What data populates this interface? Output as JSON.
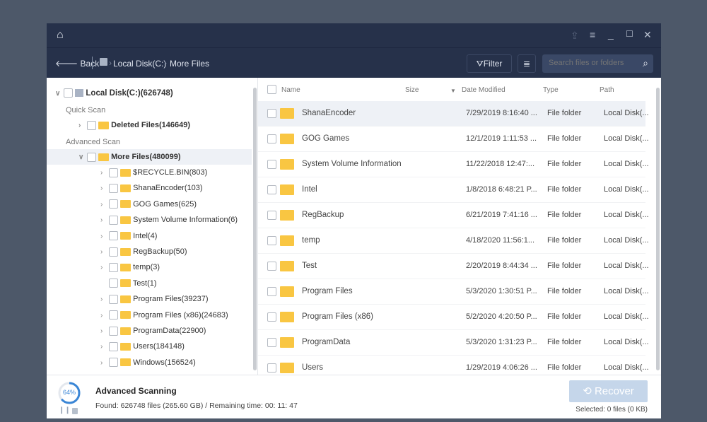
{
  "titlebar": {
    "icons": [
      "home-icon",
      "share-icon",
      "menu-icon",
      "minimize-icon",
      "maximize-icon",
      "close-icon"
    ]
  },
  "nav": {
    "back": "Back",
    "crumbs": [
      "Local Disk(C:)",
      "More Files"
    ],
    "filter": "Filter",
    "search_placeholder": "Search files or folders"
  },
  "tree": {
    "root": "Local Disk(C:)(626748)",
    "quick_scan": "Quick Scan",
    "deleted": "Deleted Files(146649)",
    "advanced_scan": "Advanced Scan",
    "more": "More Files(480099)",
    "children": [
      "$RECYCLE.BIN(803)",
      "ShanaEncoder(103)",
      "GOG Games(625)",
      "System Volume Information(6)",
      "Intel(4)",
      "RegBackup(50)",
      "temp(3)",
      "Test(1)",
      "Program Files(39237)",
      "Program Files (x86)(24683)",
      "ProgramData(22900)",
      "Users(184148)",
      "Windows(156524)"
    ]
  },
  "columns": {
    "name": "Name",
    "size": "Size",
    "date": "Date Modified",
    "type": "Type",
    "path": "Path"
  },
  "files": [
    {
      "name": "ShanaEncoder",
      "date": "7/29/2019 8:16:40 ...",
      "type": "File folder",
      "path": "Local Disk(..."
    },
    {
      "name": "GOG Games",
      "date": "12/1/2019 1:11:53 ...",
      "type": "File folder",
      "path": "Local Disk(..."
    },
    {
      "name": "System Volume Information",
      "date": "11/22/2018 12:47:...",
      "type": "File folder",
      "path": "Local Disk(..."
    },
    {
      "name": "Intel",
      "date": "1/8/2018 6:48:21 P...",
      "type": "File folder",
      "path": "Local Disk(..."
    },
    {
      "name": "RegBackup",
      "date": "6/21/2019 7:41:16 ...",
      "type": "File folder",
      "path": "Local Disk(..."
    },
    {
      "name": "temp",
      "date": "4/18/2020 11:56:1...",
      "type": "File folder",
      "path": "Local Disk(..."
    },
    {
      "name": "Test",
      "date": "2/20/2019 8:44:34 ...",
      "type": "File folder",
      "path": "Local Disk(..."
    },
    {
      "name": "Program Files",
      "date": "5/3/2020 1:30:51 P...",
      "type": "File folder",
      "path": "Local Disk(..."
    },
    {
      "name": "Program Files (x86)",
      "date": "5/2/2020 4:20:50 P...",
      "type": "File folder",
      "path": "Local Disk(..."
    },
    {
      "name": "ProgramData",
      "date": "5/3/2020 1:31:23 P...",
      "type": "File folder",
      "path": "Local Disk(..."
    },
    {
      "name": "Users",
      "date": "1/29/2019 4:06:26 ...",
      "type": "File folder",
      "path": "Local Disk(..."
    }
  ],
  "status": {
    "progress_percent": 64,
    "progress_label": "64%",
    "title": "Advanced Scanning",
    "detail": "Found: 626748 files (265.60 GB) / Remaining time: 00: 11: 47",
    "recover": "Recover",
    "selected": "Selected: 0 files (0 KB)"
  },
  "colors": {
    "header": "#26314a",
    "accent": "#3a86d6",
    "folder": "#f9c642",
    "recover_disabled": "#c5d6ea"
  }
}
